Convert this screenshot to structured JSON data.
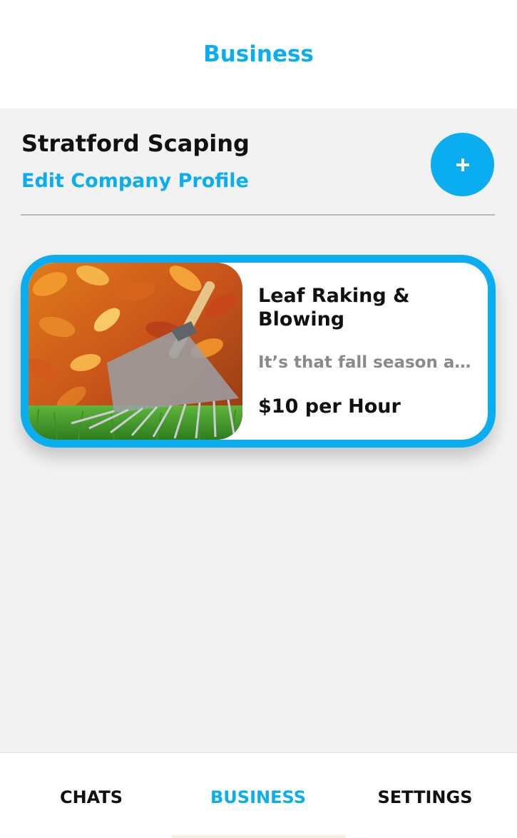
{
  "header": {
    "title": "Business"
  },
  "company": {
    "name": "Stratford Scaping",
    "edit_label": "Edit Company Profile",
    "add_label": "+"
  },
  "services": [
    {
      "title": "Leaf Raking & Blowing",
      "description": "It’s that fall season again",
      "price": "$10 per Hour",
      "image_icon": "leaf-rake-photo"
    }
  ],
  "nav": {
    "items": [
      {
        "label": "CHATS",
        "active": false
      },
      {
        "label": "BUSINESS",
        "active": true
      },
      {
        "label": "SETTINGS",
        "active": false
      }
    ]
  },
  "colors": {
    "accent": "#0aaef0",
    "background": "#f2f2f2",
    "text": "#111111",
    "muted": "#8a8a8a"
  }
}
